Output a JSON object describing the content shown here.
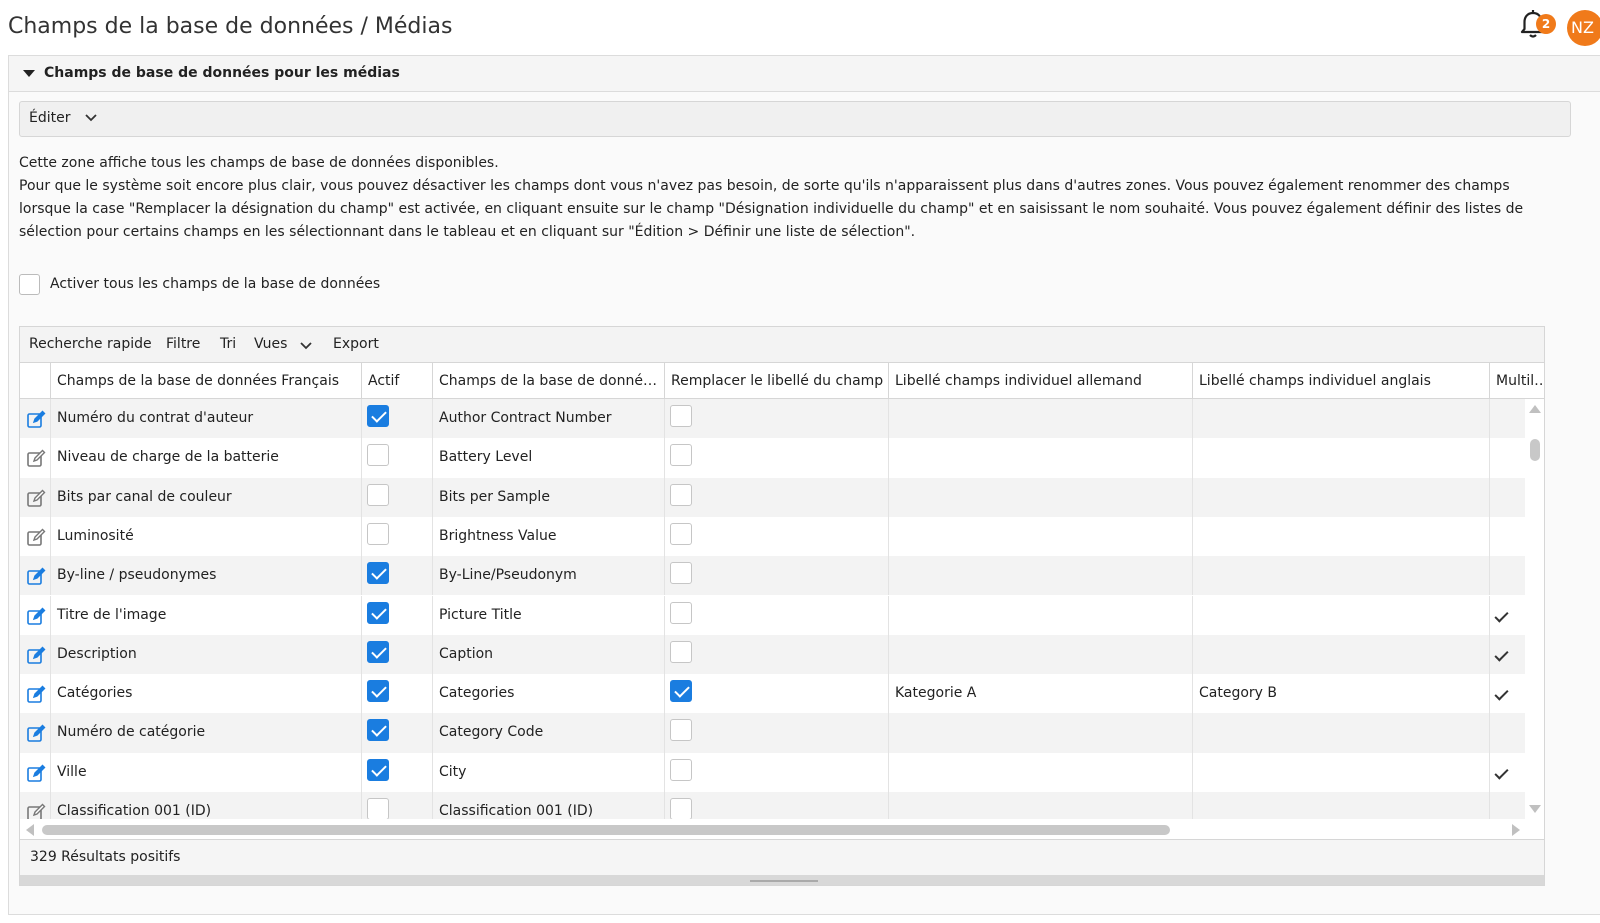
{
  "page": {
    "title": "Champs de la base de données / Médias"
  },
  "header": {
    "notification_count": "2",
    "user_initials": "NZ",
    "colors": {
      "accent": "#f07a1a",
      "checkbox": "#1a7de0"
    }
  },
  "panel": {
    "title": "Champs de base de données pour les médias",
    "edit_menu": "Éditer"
  },
  "description": {
    "line1": "Cette zone affiche tous les champs de base de données disponibles.",
    "line2": "Pour que le système soit encore plus clair, vous pouvez désactiver les champs dont vous n'avez pas besoin, de sorte qu'ils n'apparaissent plus dans d'autres zones. Vous pouvez également renommer des champs lorsque la case \"Remplacer la désignation du champ\" est activée, en cliquant ensuite sur le champ \"Désignation individuelle du champ\" et en saisissant le nom souhaité. Vous pouvez également définir des listes de sélection pour certains champs en les sélectionnant dans le tableau et en cliquant sur \"Édition > Définir une liste de sélection\"."
  },
  "activate_all": {
    "label": "Activer tous les champs de la base de données",
    "checked": false
  },
  "toolbar": {
    "quick_search": "Recherche rapide",
    "filter": "Filtre",
    "sort": "Tri",
    "views": "Vues",
    "export": "Export"
  },
  "columns": [
    "Champs de la base de données Français",
    "Actif",
    "Champs de la base de données anglais",
    "Remplacer le libellé du champ",
    "Libellé champs individuel allemand",
    "Libellé champs individuel anglais",
    "Multilingue"
  ],
  "rows": [
    {
      "fr": "Numéro du contrat d'auteur",
      "active": true,
      "en": "Author Contract Number",
      "replace": false,
      "de_label": "",
      "en_label": "",
      "multi": false
    },
    {
      "fr": "Niveau de charge de la batterie",
      "active": false,
      "en": "Battery Level",
      "replace": false,
      "de_label": "",
      "en_label": "",
      "multi": false
    },
    {
      "fr": "Bits par canal de couleur",
      "active": false,
      "en": "Bits per Sample",
      "replace": false,
      "de_label": "",
      "en_label": "",
      "multi": false
    },
    {
      "fr": "Luminosité",
      "active": false,
      "en": "Brightness Value",
      "replace": false,
      "de_label": "",
      "en_label": "",
      "multi": false
    },
    {
      "fr": "By-line / pseudonymes",
      "active": true,
      "en": "By-Line/Pseudonym",
      "replace": false,
      "de_label": "",
      "en_label": "",
      "multi": false
    },
    {
      "fr": "Titre de l'image",
      "active": true,
      "en": "Picture Title",
      "replace": false,
      "de_label": "",
      "en_label": "",
      "multi": true
    },
    {
      "fr": "Description",
      "active": true,
      "en": "Caption",
      "replace": false,
      "de_label": "",
      "en_label": "",
      "multi": true
    },
    {
      "fr": "Catégories",
      "active": true,
      "en": "Categories",
      "replace": true,
      "de_label": "Kategorie A",
      "en_label": "Category B",
      "multi": true
    },
    {
      "fr": "Numéro de catégorie",
      "active": true,
      "en": "Category Code",
      "replace": false,
      "de_label": "",
      "en_label": "",
      "multi": false
    },
    {
      "fr": "Ville",
      "active": true,
      "en": "City",
      "replace": false,
      "de_label": "",
      "en_label": "",
      "multi": true
    },
    {
      "fr": "Classification 001 (ID)",
      "active": false,
      "en": "Classification 001 (ID)",
      "replace": false,
      "de_label": "",
      "en_label": "",
      "multi": false
    }
  ],
  "footer": {
    "results": "329 Résultats positifs"
  }
}
